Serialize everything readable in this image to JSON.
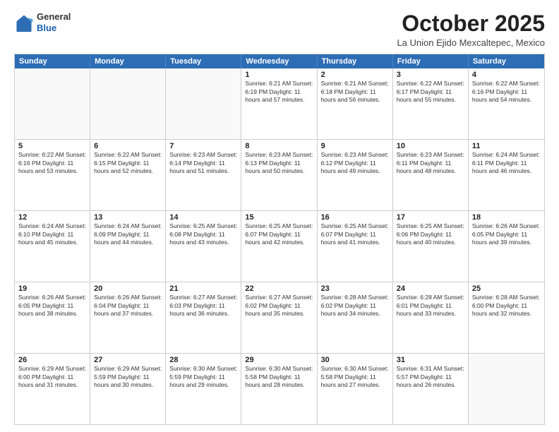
{
  "logo": {
    "general": "General",
    "blue": "Blue"
  },
  "header": {
    "month": "October 2025",
    "location": "La Union Ejido Mexcaltepec, Mexico"
  },
  "days": [
    "Sunday",
    "Monday",
    "Tuesday",
    "Wednesday",
    "Thursday",
    "Friday",
    "Saturday"
  ],
  "weeks": [
    [
      {
        "day": "",
        "text": ""
      },
      {
        "day": "",
        "text": ""
      },
      {
        "day": "",
        "text": ""
      },
      {
        "day": "1",
        "text": "Sunrise: 6:21 AM\nSunset: 6:19 PM\nDaylight: 11 hours and 57 minutes."
      },
      {
        "day": "2",
        "text": "Sunrise: 6:21 AM\nSunset: 6:18 PM\nDaylight: 11 hours and 56 minutes."
      },
      {
        "day": "3",
        "text": "Sunrise: 6:22 AM\nSunset: 6:17 PM\nDaylight: 11 hours and 55 minutes."
      },
      {
        "day": "4",
        "text": "Sunrise: 6:22 AM\nSunset: 6:16 PM\nDaylight: 11 hours and 54 minutes."
      }
    ],
    [
      {
        "day": "5",
        "text": "Sunrise: 6:22 AM\nSunset: 6:16 PM\nDaylight: 11 hours and 53 minutes."
      },
      {
        "day": "6",
        "text": "Sunrise: 6:22 AM\nSunset: 6:15 PM\nDaylight: 11 hours and 52 minutes."
      },
      {
        "day": "7",
        "text": "Sunrise: 6:23 AM\nSunset: 6:14 PM\nDaylight: 11 hours and 51 minutes."
      },
      {
        "day": "8",
        "text": "Sunrise: 6:23 AM\nSunset: 6:13 PM\nDaylight: 11 hours and 50 minutes."
      },
      {
        "day": "9",
        "text": "Sunrise: 6:23 AM\nSunset: 6:12 PM\nDaylight: 11 hours and 49 minutes."
      },
      {
        "day": "10",
        "text": "Sunrise: 6:23 AM\nSunset: 6:11 PM\nDaylight: 11 hours and 48 minutes."
      },
      {
        "day": "11",
        "text": "Sunrise: 6:24 AM\nSunset: 6:11 PM\nDaylight: 11 hours and 46 minutes."
      }
    ],
    [
      {
        "day": "12",
        "text": "Sunrise: 6:24 AM\nSunset: 6:10 PM\nDaylight: 11 hours and 45 minutes."
      },
      {
        "day": "13",
        "text": "Sunrise: 6:24 AM\nSunset: 6:09 PM\nDaylight: 11 hours and 44 minutes."
      },
      {
        "day": "14",
        "text": "Sunrise: 6:25 AM\nSunset: 6:08 PM\nDaylight: 11 hours and 43 minutes."
      },
      {
        "day": "15",
        "text": "Sunrise: 6:25 AM\nSunset: 6:07 PM\nDaylight: 11 hours and 42 minutes."
      },
      {
        "day": "16",
        "text": "Sunrise: 6:25 AM\nSunset: 6:07 PM\nDaylight: 11 hours and 41 minutes."
      },
      {
        "day": "17",
        "text": "Sunrise: 6:25 AM\nSunset: 6:06 PM\nDaylight: 11 hours and 40 minutes."
      },
      {
        "day": "18",
        "text": "Sunrise: 6:26 AM\nSunset: 6:05 PM\nDaylight: 11 hours and 39 minutes."
      }
    ],
    [
      {
        "day": "19",
        "text": "Sunrise: 6:26 AM\nSunset: 6:05 PM\nDaylight: 11 hours and 38 minutes."
      },
      {
        "day": "20",
        "text": "Sunrise: 6:26 AM\nSunset: 6:04 PM\nDaylight: 11 hours and 37 minutes."
      },
      {
        "day": "21",
        "text": "Sunrise: 6:27 AM\nSunset: 6:03 PM\nDaylight: 11 hours and 36 minutes."
      },
      {
        "day": "22",
        "text": "Sunrise: 6:27 AM\nSunset: 6:02 PM\nDaylight: 11 hours and 35 minutes."
      },
      {
        "day": "23",
        "text": "Sunrise: 6:28 AM\nSunset: 6:02 PM\nDaylight: 11 hours and 34 minutes."
      },
      {
        "day": "24",
        "text": "Sunrise: 6:28 AM\nSunset: 6:01 PM\nDaylight: 11 hours and 33 minutes."
      },
      {
        "day": "25",
        "text": "Sunrise: 6:28 AM\nSunset: 6:00 PM\nDaylight: 11 hours and 32 minutes."
      }
    ],
    [
      {
        "day": "26",
        "text": "Sunrise: 6:29 AM\nSunset: 6:00 PM\nDaylight: 11 hours and 31 minutes."
      },
      {
        "day": "27",
        "text": "Sunrise: 6:29 AM\nSunset: 5:59 PM\nDaylight: 11 hours and 30 minutes."
      },
      {
        "day": "28",
        "text": "Sunrise: 6:30 AM\nSunset: 5:59 PM\nDaylight: 11 hours and 29 minutes."
      },
      {
        "day": "29",
        "text": "Sunrise: 6:30 AM\nSunset: 5:58 PM\nDaylight: 11 hours and 28 minutes."
      },
      {
        "day": "30",
        "text": "Sunrise: 6:30 AM\nSunset: 5:58 PM\nDaylight: 11 hours and 27 minutes."
      },
      {
        "day": "31",
        "text": "Sunrise: 6:31 AM\nSunset: 5:57 PM\nDaylight: 11 hours and 26 minutes."
      },
      {
        "day": "",
        "text": ""
      }
    ]
  ]
}
